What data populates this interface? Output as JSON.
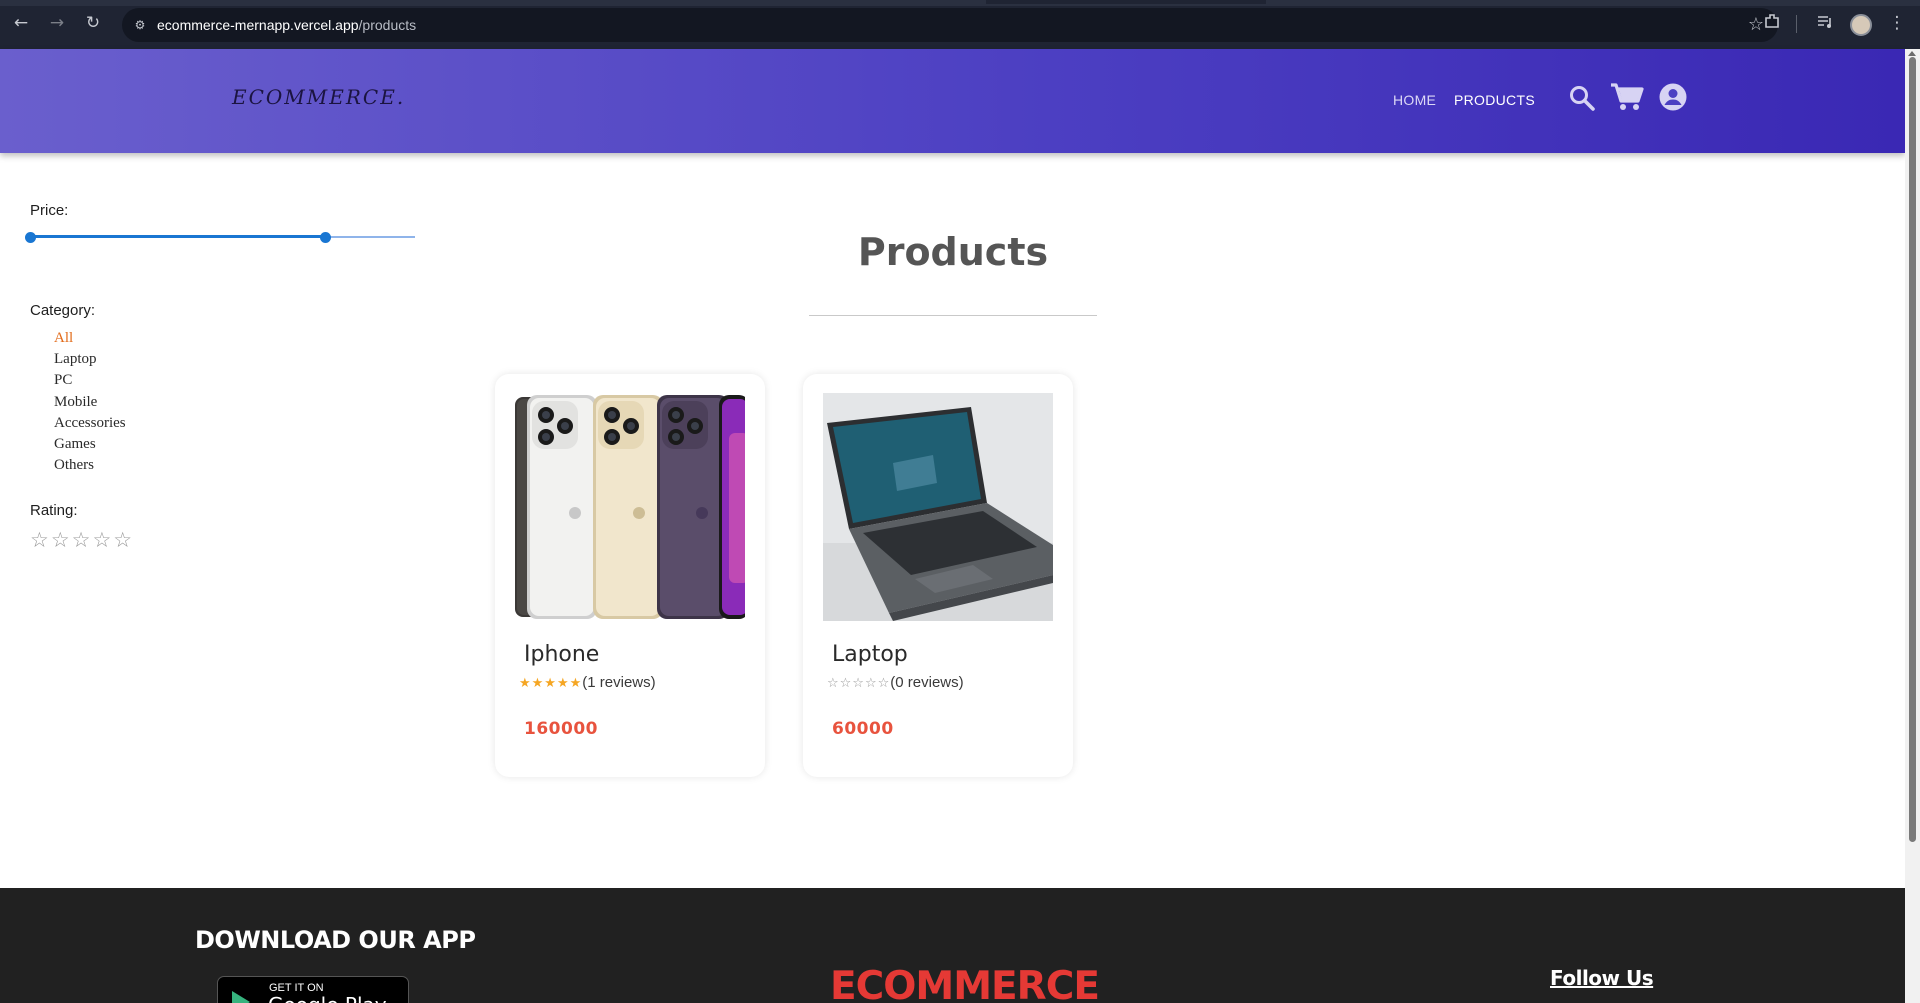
{
  "browser": {
    "url_host": "ecommerce-mernapp.vercel.app",
    "url_path": "/products"
  },
  "header": {
    "logo": "ECOMMERCE.",
    "nav": {
      "home": "HOME",
      "products": "PRODUCTS"
    }
  },
  "filters": {
    "price_label": "Price:",
    "price_range_fraction": [
      0,
      0.766
    ],
    "category_label": "Category:",
    "categories": [
      "All",
      "Laptop",
      "PC",
      "Mobile",
      "Accessories",
      "Games",
      "Others"
    ],
    "active_category": "All",
    "rating_label": "Rating:",
    "rating_stars": "☆☆☆☆☆"
  },
  "main": {
    "title": "Products",
    "products": [
      {
        "name": "Iphone",
        "stars": "★★★★★",
        "stars_empty": "",
        "reviews": "(1 reviews)",
        "price": "160000",
        "rating": 5
      },
      {
        "name": "Laptop",
        "stars": "",
        "stars_empty": "☆☆☆☆☆",
        "reviews": "(0 reviews)",
        "price": "60000",
        "rating": 0
      }
    ]
  },
  "footer": {
    "download_title": "DOWNLOAD OUR APP",
    "store_top": "GET IT ON",
    "store_name": "Google Play",
    "brand": "ECOMMERCE",
    "follow_us": "Follow Us"
  },
  "colors": {
    "header_gradient": [
      "#6a5fcd",
      "#3a28b4"
    ],
    "active_category": "#e26b1a",
    "price": "#e8533e",
    "star_fill": "#f5a623",
    "slider": "#1976d2",
    "footer_bg": "#212121",
    "footer_brand": "#e53935"
  }
}
